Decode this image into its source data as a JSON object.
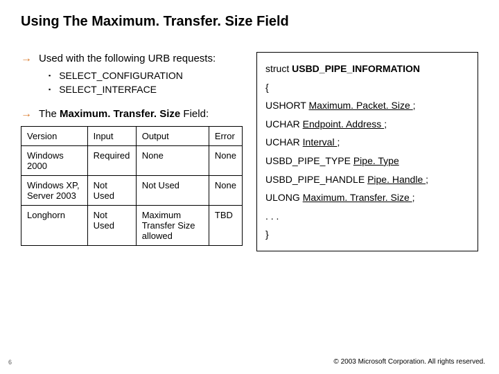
{
  "title": "Using The Maximum. Transfer. Size Field",
  "bullets": {
    "b1": "Used with the following URB requests:",
    "s1": "SELECT_CONFIGURATION",
    "s2": "SELECT_INTERFACE",
    "b2_pre": "The ",
    "b2_bold": "Maximum. Transfer. Size",
    "b2_post": " Field:"
  },
  "table": {
    "h": {
      "c0": "Version",
      "c1": "Input",
      "c2": "Output",
      "c3": "Error"
    },
    "r0": {
      "c0": "Windows 2000",
      "c1": "Required",
      "c2": "None",
      "c3": "None"
    },
    "r1": {
      "c0": "Windows XP, Server 2003",
      "c1": "Not Used",
      "c2": "Not Used",
      "c3": "None"
    },
    "r2": {
      "c0": "Longhorn",
      "c1": "Not Used",
      "c2": "Maximum Transfer Size allowed",
      "c3": "TBD"
    }
  },
  "code": {
    "l0a": "struct ",
    "l0b": "USBD_PIPE_INFORMATION",
    "l1": "{",
    "l2a": "USHORT ",
    "l2b": "Maximum. Packet. Size ",
    "l2c": ";",
    "l3a": "UCHAR ",
    "l3b": "Endpoint. Address ",
    "l3c": ";",
    "l4a": "UCHAR ",
    "l4b": "Interval ",
    "l4c": ";",
    "l5a": "USBD_PIPE_TYPE ",
    "l5b": "Pipe. Type",
    "l6a": "USBD_PIPE_HANDLE ",
    "l6b": "Pipe. Handle ",
    "l6c": ";",
    "l7a": "ULONG ",
    "l7b": "Maximum. Transfer. Size ",
    "l7c": ";",
    "l8": ". . .",
    "l9": "}"
  },
  "footer": {
    "num": "6",
    "copy": "© 2003 Microsoft Corporation. All rights reserved."
  }
}
